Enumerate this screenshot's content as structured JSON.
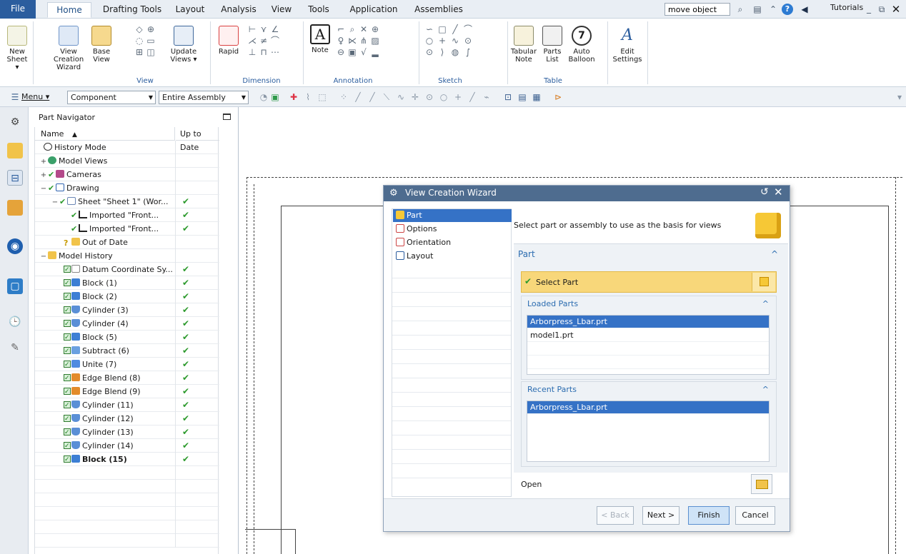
{
  "tabs": {
    "file": "File",
    "items": [
      "Home",
      "Drafting Tools",
      "Layout",
      "Analysis",
      "View",
      "Tools",
      "Application",
      "Assemblies"
    ],
    "active": "Home"
  },
  "search": {
    "value": "move object"
  },
  "tutorials": "Tutorials",
  "ribbon": {
    "new_sheet": "New Sheet ▾",
    "view_creation_wizard": "View Creation Wizard",
    "base_view": "Base View",
    "update_views": "Update Views ▾",
    "rapid": "Rapid",
    "note": "Note",
    "tabular_note": "Tabular Note",
    "parts_list": "Parts List",
    "auto_balloon": "Auto Balloon",
    "edit_settings": "Edit Settings",
    "groups": {
      "view": "View",
      "dimension": "Dimension",
      "annotation": "Annotation",
      "sketch": "Sketch",
      "table": "Table"
    }
  },
  "selection_bar": {
    "menu": "Menu ▾",
    "filter": "Component",
    "scope": "Entire Assembly"
  },
  "navigator": {
    "title": "Part Navigator",
    "col_name": "Name",
    "col_status": "Up to Date",
    "rows": [
      {
        "label": "History Mode"
      },
      {
        "label": "Model Views"
      },
      {
        "label": "Cameras"
      },
      {
        "label": "Drawing"
      },
      {
        "label": "Sheet \"Sheet 1\" (Wor...",
        "status": "✔"
      },
      {
        "label": "Imported \"Front...",
        "status": "✔"
      },
      {
        "label": "Imported \"Front...",
        "status": "✔"
      },
      {
        "label": "Out of Date"
      },
      {
        "label": "Model History"
      },
      {
        "label": "Datum Coordinate Sy...",
        "status": "✔"
      },
      {
        "label": "Block (1)",
        "status": "✔"
      },
      {
        "label": "Block (2)",
        "status": "✔"
      },
      {
        "label": "Cylinder (3)",
        "status": "✔"
      },
      {
        "label": "Cylinder (4)",
        "status": "✔"
      },
      {
        "label": "Block (5)",
        "status": "✔"
      },
      {
        "label": "Subtract (6)",
        "status": "✔"
      },
      {
        "label": "Unite (7)",
        "status": "✔"
      },
      {
        "label": "Edge Blend (8)",
        "status": "✔"
      },
      {
        "label": "Edge Blend (9)",
        "status": "✔"
      },
      {
        "label": "Cylinder (11)",
        "status": "✔"
      },
      {
        "label": "Cylinder (12)",
        "status": "✔"
      },
      {
        "label": "Cylinder (13)",
        "status": "✔"
      },
      {
        "label": "Cylinder (14)",
        "status": "✔"
      },
      {
        "label": "Block (15)",
        "status": "✔"
      }
    ]
  },
  "dialog": {
    "title": "View Creation Wizard",
    "steps": [
      "Part",
      "Options",
      "Orientation",
      "Layout"
    ],
    "selected_step": "Part",
    "prompt": "Select part or assembly to use as the basis for views",
    "section_part": "Part",
    "select_part": "Select Part",
    "loaded_parts_label": "Loaded Parts",
    "loaded_parts": [
      "Arborpress_Lbar.prt",
      "model1.prt"
    ],
    "recent_parts_label": "Recent Parts",
    "recent_parts": [
      "Arborpress_Lbar.prt"
    ],
    "open_label": "Open",
    "buttons": {
      "back": "< Back",
      "next": "Next >",
      "finish": "Finish",
      "cancel": "Cancel"
    }
  },
  "colors": {
    "accent": "#2b5d9e",
    "selection": "#3572c6",
    "highlight": "#f8d77a",
    "dialog_title": "#4e6c8f",
    "status_ok": "#2d9a2d"
  }
}
